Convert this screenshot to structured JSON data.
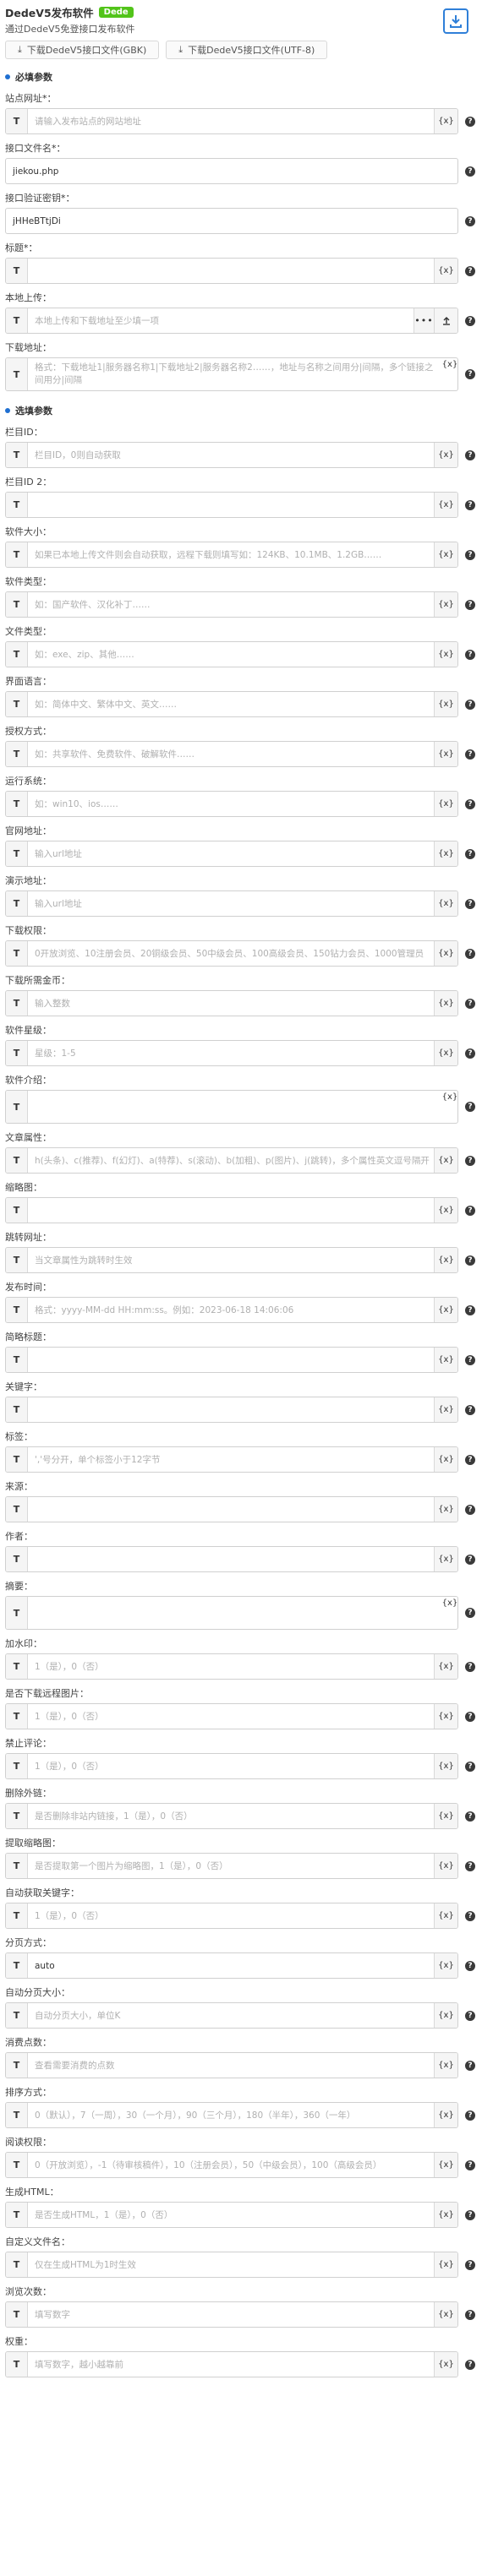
{
  "header": {
    "title": "DedeV5发布软件",
    "badge": "Dede",
    "subtitle": "通过DedeV5免登接口发布软件",
    "icon": "download-box-icon",
    "btn_gbk": "下载DedeV5接口文件(GBK)",
    "btn_utf8": "下载DedeV5接口文件(UTF-8)"
  },
  "colors": {
    "accent": "#1f6fd1",
    "badge": "#52c41a"
  },
  "required_section": "必填参数",
  "optional_section": "选填参数",
  "required_fields": [
    {
      "label": "站点网址",
      "req": "*：",
      "placeholder": "请输入发布站点的网站地址",
      "value": "",
      "x": true
    },
    {
      "label": "接口文件名",
      "req": "*：",
      "placeholder": "",
      "value": "jiekou.php",
      "prefix": false
    },
    {
      "label": "接口验证密钥",
      "req": "*：",
      "placeholder": "",
      "value": "jHHeBTtjDi",
      "prefix": false
    },
    {
      "label": "标题",
      "req": "*：",
      "placeholder": "",
      "value": "",
      "x": true
    },
    {
      "label": "本地上传",
      "req": "：",
      "placeholder": "本地上传和下载地址至少填一项",
      "value": "",
      "upload": true
    },
    {
      "label": "下载地址",
      "req": "：",
      "placeholder": "格式：下载地址1|服务器名称1|下载地址2|服务器名称2……，地址与名称之间用分|间隔，多个链接之间用分|间隔",
      "value": "",
      "tall": true
    }
  ],
  "optional_fields": [
    {
      "label": "栏目ID：",
      "placeholder": "栏目ID，0则自动获取",
      "value": "",
      "x": true
    },
    {
      "label": "栏目ID 2：",
      "placeholder": "",
      "value": "",
      "x": true
    },
    {
      "label": "软件大小：",
      "placeholder": "如果已本地上传文件则会自动获取，远程下载则填写如：124KB、10.1MB、1.2GB……",
      "value": "",
      "x": true
    },
    {
      "label": "软件类型：",
      "placeholder": "如：国产软件、汉化补丁……",
      "value": "",
      "x": true
    },
    {
      "label": "文件类型：",
      "placeholder": "如：exe、zip、其他……",
      "value": "",
      "x": true
    },
    {
      "label": "界面语言：",
      "placeholder": "如：简体中文、繁体中文、英文……",
      "value": "",
      "x": true
    },
    {
      "label": "授权方式：",
      "placeholder": "如：共享软件、免费软件、破解软件……",
      "value": "",
      "x": true
    },
    {
      "label": "运行系统：",
      "placeholder": "如：win10、ios……",
      "value": "",
      "x": true
    },
    {
      "label": "官网地址：",
      "placeholder": "输入url地址",
      "value": "",
      "x": true
    },
    {
      "label": "演示地址：",
      "placeholder": "输入url地址",
      "value": "",
      "x": true
    },
    {
      "label": "下载权限：",
      "placeholder": "0开放浏览、10注册会员、20铜级会员、50中级会员、100高级会员、150钻力会员、1000管理员",
      "value": "",
      "x": true
    },
    {
      "label": "下载所需金币：",
      "placeholder": "输入整数",
      "value": "",
      "x": true
    },
    {
      "label": "软件星级：",
      "placeholder": "星级：1-5",
      "value": "",
      "x": true
    },
    {
      "label": "软件介绍：",
      "placeholder": "",
      "value": "",
      "textarea": true
    },
    {
      "label": "文章属性：",
      "placeholder": "h(头条)、c(推荐)、f(幻灯)、a(特荐)、s(滚动)、b(加粗)、p(图片)、j(跳转)，多个属性英文逗号隔开",
      "value": "",
      "x": true
    },
    {
      "label": "缩略图：",
      "placeholder": "",
      "value": "",
      "x": true
    },
    {
      "label": "跳转网址：",
      "placeholder": "当文章属性为跳转时生效",
      "value": "",
      "x": true
    },
    {
      "label": "发布时间：",
      "placeholder": "格式：yyyy-MM-dd HH:mm:ss。例如：2023-06-18 14:06:06",
      "value": "",
      "x": true
    },
    {
      "label": "简略标题：",
      "placeholder": "",
      "value": "",
      "x": true
    },
    {
      "label": "关键字：",
      "placeholder": "",
      "value": "",
      "x": true
    },
    {
      "label": "标签：",
      "placeholder": "','号分开，单个标签小于12字节",
      "value": "",
      "x": true
    },
    {
      "label": "来源：",
      "placeholder": "",
      "value": "",
      "x": true
    },
    {
      "label": "作者：",
      "placeholder": "",
      "value": "",
      "x": true
    },
    {
      "label": "摘要：",
      "placeholder": "",
      "value": "",
      "textarea": true
    },
    {
      "label": "加水印：",
      "placeholder": "1（是），0（否）",
      "value": "",
      "x": true
    },
    {
      "label": "是否下载远程图片：",
      "placeholder": "1（是），0（否）",
      "value": "",
      "x": true
    },
    {
      "label": "禁止评论：",
      "placeholder": "1（是），0（否）",
      "value": "",
      "x": true
    },
    {
      "label": "删除外链：",
      "placeholder": "是否删除非站内链接，1（是），0（否）",
      "value": "",
      "x": true
    },
    {
      "label": "提取缩略图：",
      "placeholder": "是否提取第一个图片为缩略图，1（是），0（否）",
      "value": "",
      "x": true
    },
    {
      "label": "自动获取关键字：",
      "placeholder": "1（是），0（否）",
      "value": "",
      "x": true
    },
    {
      "label": "分页方式：",
      "placeholder": "",
      "value": "auto",
      "x": true
    },
    {
      "label": "自动分页大小：",
      "placeholder": "自动分页大小，单位K",
      "value": "",
      "x": true
    },
    {
      "label": "消费点数：",
      "placeholder": "查看需要消费的点数",
      "value": "",
      "x": true
    },
    {
      "label": "排序方式：",
      "placeholder": "0（默认），7（一周），30（一个月），90（三个月），180（半年），360（一年）",
      "value": "",
      "x": true
    },
    {
      "label": "阅读权限：",
      "placeholder": "0（开放浏览），-1（待审核稿件），10（注册会员），50（中级会员），100（高级会员）",
      "value": "",
      "x": true
    },
    {
      "label": "生成HTML：",
      "placeholder": "是否生成HTML，1（是），0（否）",
      "value": "",
      "x": true
    },
    {
      "label": "自定义文件名：",
      "placeholder": "仅在生成HTML为1时生效",
      "value": "",
      "x": true
    },
    {
      "label": "浏览次数：",
      "placeholder": "填写数字",
      "value": "",
      "x": true
    },
    {
      "label": "权重：",
      "placeholder": "填写数字，越小越靠前",
      "value": "",
      "x": true
    }
  ],
  "x_label": "{x}",
  "prefix_label": "T",
  "dots_label": "•••",
  "help_label": "?"
}
